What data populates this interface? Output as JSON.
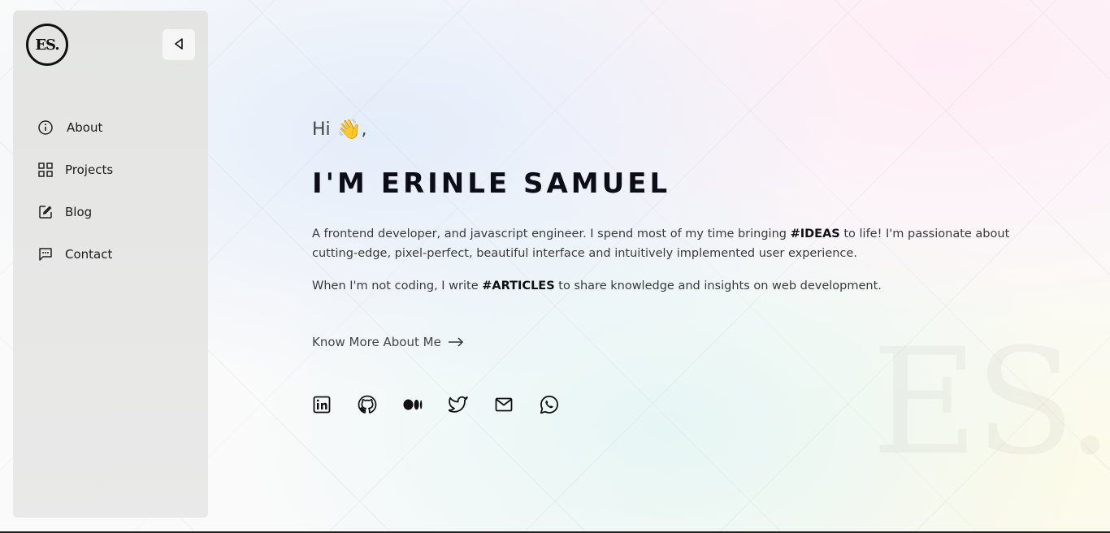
{
  "sidebar": {
    "logo_text": "ES.",
    "collapse_icon": "triangle-left-icon",
    "items": [
      {
        "label": "About",
        "icon": "info-icon"
      },
      {
        "label": "Projects",
        "icon": "grid-icon"
      },
      {
        "label": "Blog",
        "icon": "edit-icon"
      },
      {
        "label": "Contact",
        "icon": "message-icon"
      }
    ]
  },
  "hero": {
    "greeting": "Hi",
    "greeting_emoji": "👋",
    "greeting_suffix": ",",
    "title": "I'M ERINLE SAMUEL",
    "intro_part1": "A frontend developer, and javascript engineer. I spend most of my time bringing ",
    "intro_highlight": "#IDEAS",
    "intro_part2": " to life! I'm passionate about cutting-edge, pixel-perfect, beautiful interface and intuitively implemented user experience.",
    "intro2_part1": "When I'm not coding, I write ",
    "intro2_highlight": "#ARTICLES",
    "intro2_part2": " to share knowledge and insights on web development.",
    "cta_label": "Know More About Me"
  },
  "socials": [
    "linkedin-icon",
    "github-icon",
    "medium-icon",
    "twitter-icon",
    "mail-icon",
    "whatsapp-icon"
  ],
  "watermark": "ES.",
  "colors": {
    "sidebar_bg": "#e6e6e5",
    "text_dark": "#0d0d18",
    "text_body": "#3a3a3a"
  }
}
